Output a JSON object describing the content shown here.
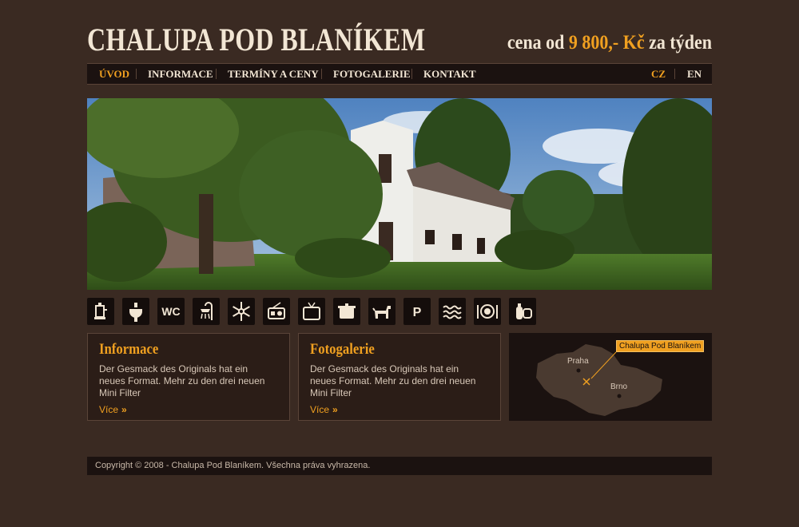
{
  "header": {
    "title": "CHALUPA POD BLANÍKEM",
    "price_prefix": "cena od",
    "price_value": "9 800,- Kč",
    "price_suffix": "za týden"
  },
  "nav": {
    "items": [
      {
        "label": "ÚVOD",
        "active": true
      },
      {
        "label": "INFORMACE"
      },
      {
        "label": "TERMÍNY A CENY"
      },
      {
        "label": "FOTOGALERIE"
      },
      {
        "label": "KONTAKT"
      }
    ],
    "languages": [
      {
        "label": "CZ",
        "active": true
      },
      {
        "label": "EN"
      }
    ]
  },
  "amenities": [
    "cooker-icon",
    "washbasin-icon",
    "wc-icon",
    "shower-icon",
    "freezer-icon",
    "radio-icon",
    "tv-icon",
    "pot-icon",
    "dog-icon",
    "parking-icon",
    "heating-icon",
    "dining-icon",
    "gas-icon"
  ],
  "amenity_texts": {
    "wc": "WC",
    "parking": "P"
  },
  "boxes": [
    {
      "title": "Informace",
      "text": "Der Gesmack des Originals hat ein neues Format. Mehr zu den drei neuen Mini Filter",
      "more": "Více",
      "more_arrow": "»"
    },
    {
      "title": "Fotogalerie",
      "text": "Der Gesmack des Originals hat ein neues Format. Mehr zu den drei neuen Mini Filter",
      "more": "Více",
      "more_arrow": "»"
    }
  ],
  "map": {
    "tag": "Chalupa Pod Blaníkem",
    "cities": [
      "Praha",
      "Brno"
    ]
  },
  "footer": {
    "copyright": "Copyright © 2008 - Chalupa Pod Blaníkem. Všechna práva vyhrazena."
  },
  "colors": {
    "background": "#3a2a22",
    "accent": "#f0a020",
    "dark": "#1b1210"
  }
}
